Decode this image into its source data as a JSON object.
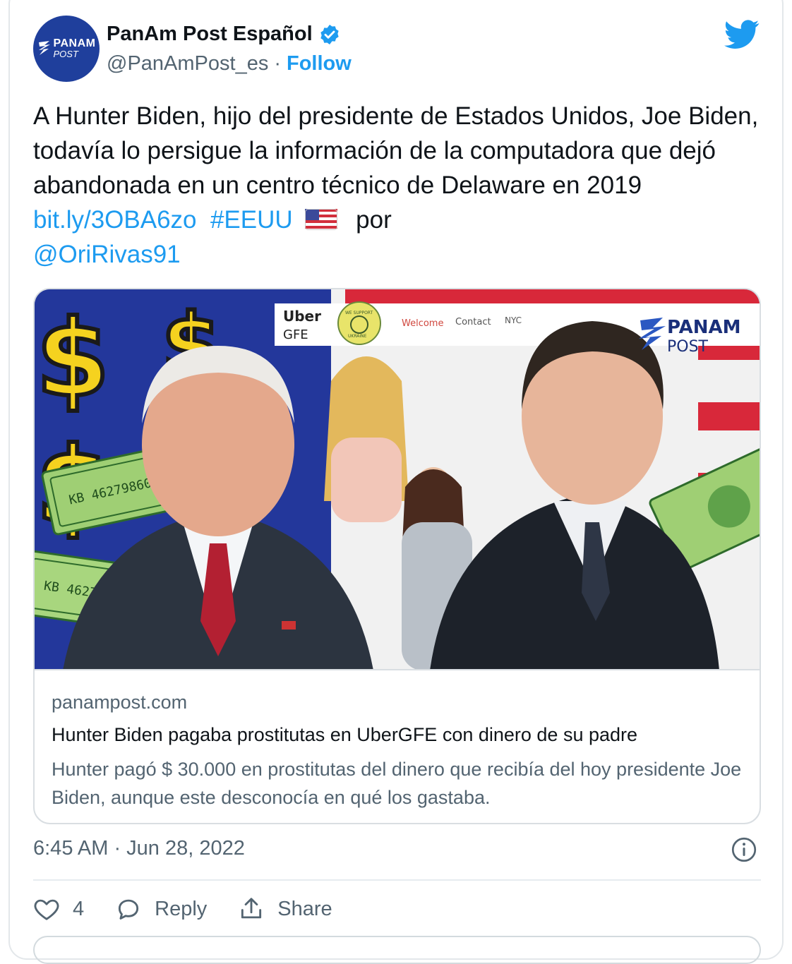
{
  "header": {
    "display_name": "PanAm Post Español",
    "handle": "@PanAmPost_es",
    "separator": "·",
    "follow_label": "Follow",
    "avatar_text_top": "PANAM",
    "avatar_text_bottom": "POST"
  },
  "tweet": {
    "text": "A Hunter Biden, hijo del presidente de Estados Unidos, Joe Biden, todavía lo persigue la información de la computadora que dejó abandonada en un centro técnico de Delaware en 2019",
    "link": "bit.ly/3OBA6zo",
    "hashtag": "#EEUU",
    "flag": "🇺🇸",
    "by": "por",
    "mention": "@OriRivas91"
  },
  "link_card": {
    "image_texts": {
      "uber": "Uber",
      "gfe": "GFE",
      "badge_top": "WE SUPPORT",
      "badge_bottom": "UKRAINE",
      "nav_welcome": "Welcome",
      "nav_contact": "Contact",
      "nav_nyc": "NYC",
      "logo_top": "PANAM",
      "logo_bottom": "POST"
    },
    "domain": "panampost.com",
    "title": "Hunter Biden pagaba prostitutas en UberGFE con dinero de su padre",
    "description": "Hunter pagó $ 30.000 en prostitutas del dinero que recibía del hoy presidente Joe Biden, aunque este desconocía en qué los gastaba."
  },
  "footer": {
    "timestamp": "6:45 AM · Jun 28, 2022",
    "like_count": "4",
    "reply_label": "Reply",
    "share_label": "Share"
  },
  "colors": {
    "accent": "#1d9bf0",
    "text": "#0f1419",
    "secondary": "#536471",
    "avatar_bg": "#1f3f9c"
  }
}
